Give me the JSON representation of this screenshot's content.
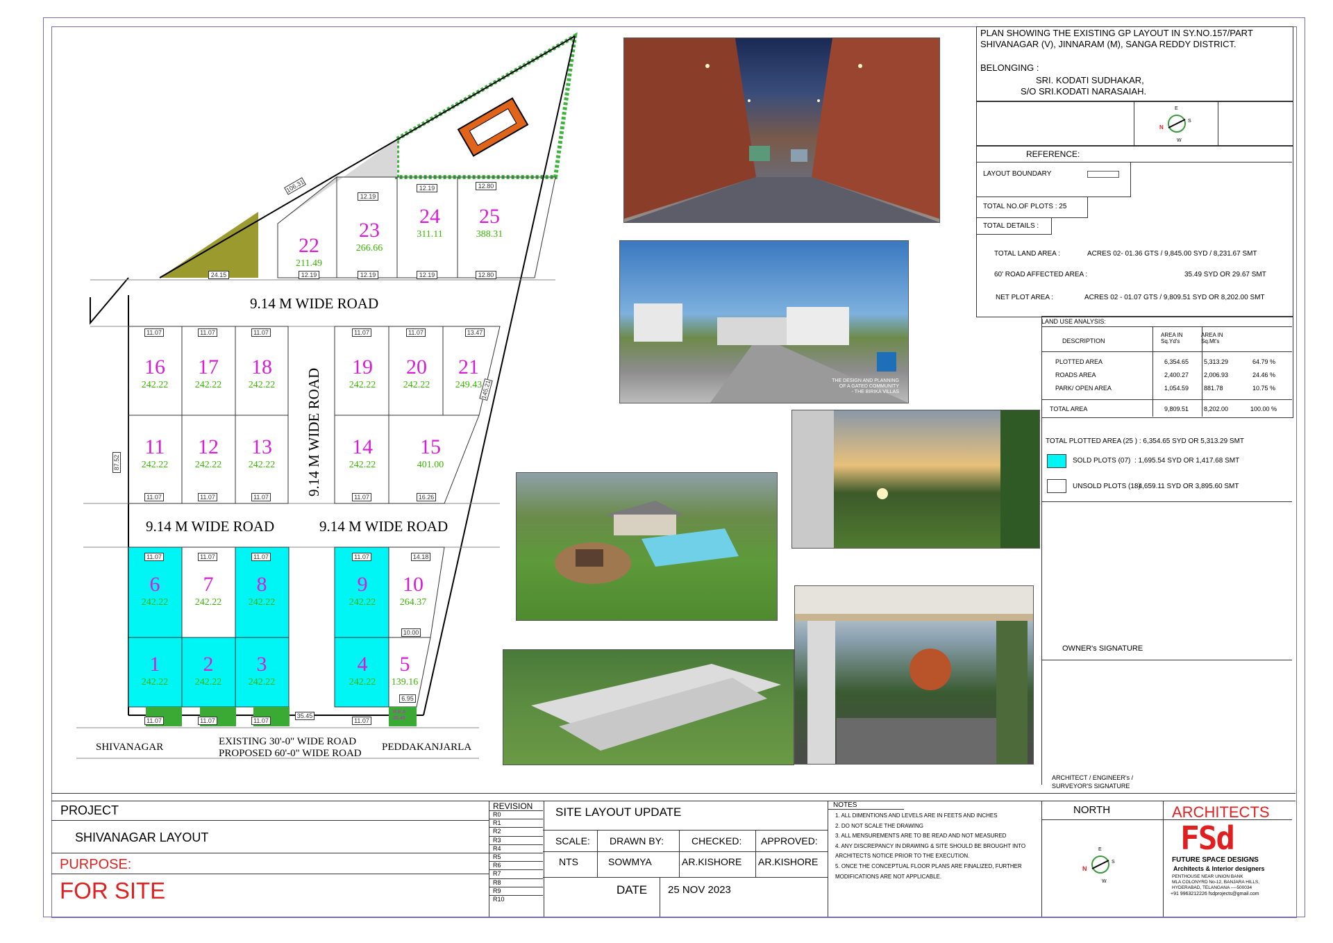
{
  "title": {
    "line1": "PLAN SHOWING THE EXISTING GP LAYOUT IN SY.NO.157/PART",
    "line2": "SHIVANAGAR (V), JINNARAM (M), SANGA REDDY  DISTRICT.",
    "belonging_label": "BELONGING :",
    "owner1": "SRI. KODATI SUDHAKAR,",
    "owner2": "S/O SRI.KODATI NARASAIAH."
  },
  "compass": {
    "e": "E",
    "s": "S",
    "n": "N",
    "w": "W"
  },
  "reference": {
    "label": "REFERENCE:",
    "layout_boundary": "LAYOUT  BOUNDARY",
    "total_plots": "TOTAL NO.OF PLOTS  : 25",
    "total_details": "TOTAL DETAILS :"
  },
  "totals": {
    "land_label": "TOTAL LAND AREA :",
    "land_value": "ACRES 02- 01.36 GTS /  9,845.00 SYD /    8,231.67 SMT",
    "road_label": "60' ROAD AFFECTED AREA   :",
    "road_value": "35.49 SYD  OR     29.67 SMT",
    "net_label": "NET PLOT  AREA :",
    "net_value": "ACRES 02 - 01.07 GTS / 9,809.51 SYD  OR  8,202.00 SMT"
  },
  "land_use": {
    "title": "LAND USE ANALYSIS:",
    "headers": [
      "DESCRIPTION",
      "AREA IN Sq.Yd's",
      "AREA IN Sq.Mt's"
    ],
    "rows": [
      {
        "desc": "PLOTTED AREA",
        "syd": "6,354.65",
        "smt": "5,313.29",
        "pct": "64.79 %"
      },
      {
        "desc": "ROADS  AREA",
        "syd": "2,400.27",
        "smt": "2,006.93",
        "pct": "24.46 %"
      },
      {
        "desc": "PARK/  OPEN  AREA",
        "syd": "1,054.59",
        "smt": "881.78",
        "pct": "10.75 %"
      }
    ],
    "total": {
      "desc": "TOTAL  AREA",
      "syd": "9,809.51",
      "smt": "8,202.00",
      "pct": "100.00 %"
    }
  },
  "summary": {
    "plotted": "TOTAL  PLOTTED AREA  (25 )    : 6,354.65  SYD  OR     5,313.29 SMT",
    "sold_label": "SOLD PLOTS  (07)",
    "sold_value": ": 1,695.54  SYD  OR     1,417.68 SMT",
    "unsold_label": "UNSOLD PLOTS (18)",
    "unsold_value": ": 4,659.11  SYD  OR     3,895.60 SMT",
    "sold_color": "#00f5f5"
  },
  "signatures": {
    "owner": "OWNER's  SIGNATURE",
    "architect1": "ARCHITECT / ENGINEER's /",
    "architect2": "SURVEYOR'S SIGNATURE"
  },
  "plan": {
    "roads": {
      "top": "9.14 M WIDE ROAD",
      "vertical": "9.14 M WIDE ROAD",
      "mid_left": "9.14 M WIDE ROAD",
      "mid_right": "9.14 M WIDE ROAD",
      "existing": "EXISTING   30'-0\"  WIDE ROAD",
      "proposed": "PROPOSED 60'-0\"  WIDE ROAD",
      "shivanagar": "SHIVANAGAR",
      "peddakanjarla": "PEDDAKANJARLA"
    },
    "rea_label": "R.E.A",
    "rea_value": "35.49",
    "plots": [
      {
        "n": "1",
        "area": "242.22",
        "sold": true
      },
      {
        "n": "2",
        "area": "242.22",
        "sold": true
      },
      {
        "n": "3",
        "area": "242.22",
        "sold": true
      },
      {
        "n": "4",
        "area": "242.22",
        "sold": true
      },
      {
        "n": "5",
        "area": "139.16",
        "sold": false
      },
      {
        "n": "6",
        "area": "242.22",
        "sold": true
      },
      {
        "n": "7",
        "area": "242.22",
        "sold": false
      },
      {
        "n": "8",
        "area": "242.22",
        "sold": true
      },
      {
        "n": "9",
        "area": "242.22",
        "sold": true
      },
      {
        "n": "10",
        "area": "264.37",
        "sold": false
      },
      {
        "n": "11",
        "area": "242.22",
        "sold": false
      },
      {
        "n": "12",
        "area": "242.22",
        "sold": false
      },
      {
        "n": "13",
        "area": "242.22",
        "sold": false
      },
      {
        "n": "14",
        "area": "242.22",
        "sold": false
      },
      {
        "n": "15",
        "area": "401.00",
        "sold": false
      },
      {
        "n": "16",
        "area": "242.22",
        "sold": false
      },
      {
        "n": "17",
        "area": "242.22",
        "sold": false
      },
      {
        "n": "18",
        "area": "242.22",
        "sold": false
      },
      {
        "n": "19",
        "area": "242.22",
        "sold": false
      },
      {
        "n": "20",
        "area": "242.22",
        "sold": false
      },
      {
        "n": "21",
        "area": "249.43",
        "sold": false
      },
      {
        "n": "22",
        "area": "211.49",
        "sold": false
      },
      {
        "n": "23",
        "area": "266.66",
        "sold": false
      },
      {
        "n": "24",
        "area": "311.11",
        "sold": false
      },
      {
        "n": "25",
        "area": "388.31",
        "sold": false
      }
    ],
    "dims": {
      "d1107": "11.07",
      "d1219": "12.19",
      "d1280": "12.80",
      "d1347": "13.47",
      "d1626": "16.26",
      "d1418": "14.18",
      "d1000": "10.00",
      "d695": "6.95",
      "d2415": "24.15",
      "d10631": "106.31",
      "d8752": "87.52",
      "d14521": "145.21",
      "d3545": "35.45"
    }
  },
  "photo_caption": {
    "line1": "THE DESIGN AND PLANNING",
    "line2": "OF A GATED COMMUNITY",
    "line3": "- THE BIRIKA VILLAS"
  },
  "title_block": {
    "project_label": "PROJECT",
    "project_name": "SHIVANAGAR LAYOUT",
    "purpose_label": "PURPOSE:",
    "purpose_value": "FOR SITE",
    "revision_label": "REVISION",
    "revisions": [
      "R0",
      "R1",
      "R2",
      "R3",
      "R4",
      "R5",
      "R6",
      "R7",
      "R8",
      "R9",
      "R10"
    ],
    "sheet_title": "SITE LAYOUT UPDATE",
    "scale_label": "SCALE:",
    "scale_value": "NTS",
    "drawn_label": "DRAWN BY:",
    "drawn_value": "SOWMYA",
    "checked_label": "CHECKED:",
    "checked_value": "AR.KISHORE",
    "approved_label": "APPROVED:",
    "approved_value": "AR.KISHORE",
    "date_label": "DATE",
    "date_value": "25 NOV 2023",
    "notes_label": "NOTES",
    "notes": [
      "1.   ALL DIMENTIONS AND LEVELS ARE IN FEETS AND INCHES",
      "2.   DO NOT SCALE THE DRAWING",
      "3.   ALL MENSUREMENTS ARE TO BE  READ AND NOT MEASURED",
      "4.   ANY DISCREPANCY IN DRAWING & SITE SHOULD BE BROUGHT INTO",
      "      ARCHITECTS NOTICE PRIOR TO THE EXECUTION.",
      "5.   ONCE THE CONCEPTUAL FLOOR PLANS ARE FINALIZED, FURTHER",
      "      MODIFICATIONS ARE NOT APPLICABLE."
    ],
    "north_label": "NORTH",
    "architects_label": "ARCHITECTS",
    "logo_text": "FSd",
    "firm_name": "FUTURE SPACE DESIGNS",
    "firm_sub": "Architects  &  Interior designers",
    "addr1": "PENTHOUSE    NEAR UNION BANK",
    "addr2": "MLA COLONYRD No-12,  BANJARA HILLS,",
    "addr3": "HYDERABAD, TELANGANA ----500034",
    "contact": "+91 9963212226   fsdprojects@gmail.com",
    "accent_red": "#e02020"
  }
}
